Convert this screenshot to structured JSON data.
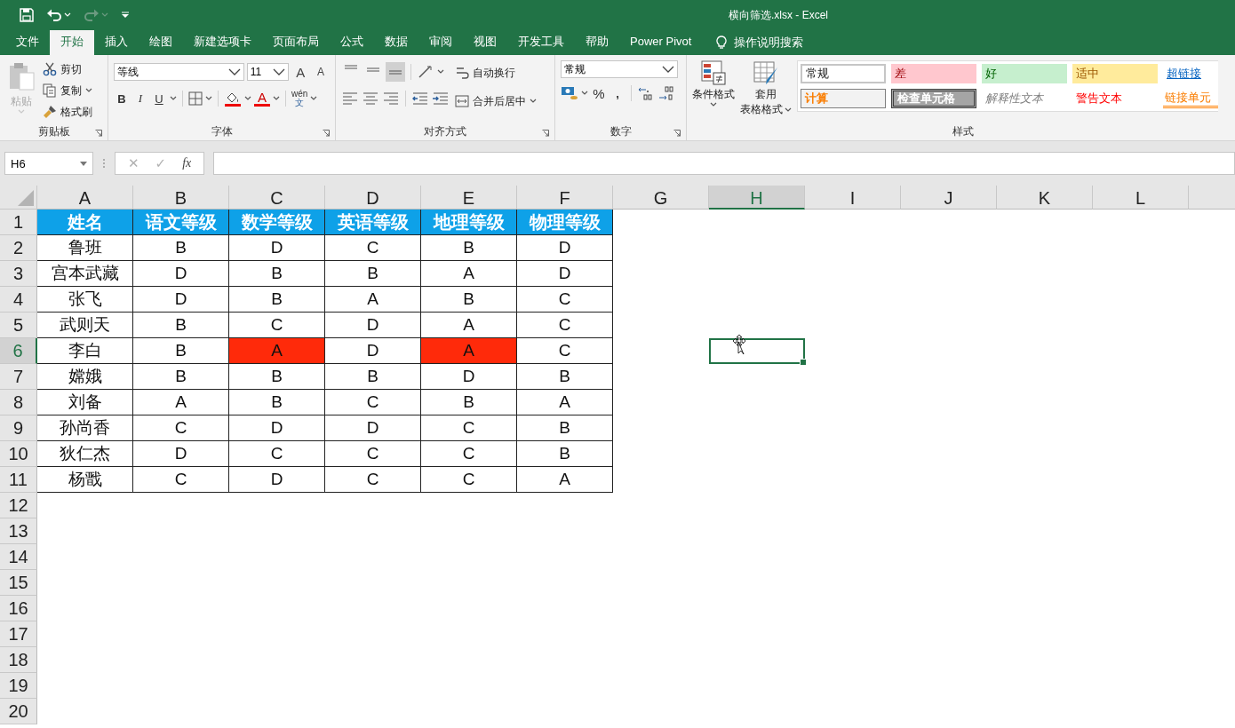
{
  "title_bar": {
    "title": "横向筛选.xlsx  -  Excel"
  },
  "quick_access": {
    "redo_disabled": true
  },
  "menu_tabs": [
    {
      "label": "文件",
      "selected": false,
      "kind": "tab"
    },
    {
      "label": "开始",
      "selected": true,
      "kind": "tab"
    },
    {
      "label": "插入",
      "selected": false,
      "kind": "tab"
    },
    {
      "label": "绘图",
      "selected": false,
      "kind": "tab"
    },
    {
      "label": "新建选项卡",
      "selected": false,
      "kind": "tab"
    },
    {
      "label": "页面布局",
      "selected": false,
      "kind": "tab"
    },
    {
      "label": "公式",
      "selected": false,
      "kind": "tab"
    },
    {
      "label": "数据",
      "selected": false,
      "kind": "tab"
    },
    {
      "label": "审阅",
      "selected": false,
      "kind": "tab"
    },
    {
      "label": "视图",
      "selected": false,
      "kind": "tab"
    },
    {
      "label": "开发工具",
      "selected": false,
      "kind": "tab"
    },
    {
      "label": "帮助",
      "selected": false,
      "kind": "tab"
    },
    {
      "label": "Power Pivot",
      "selected": false,
      "kind": "tab"
    },
    {
      "label": "操作说明搜索",
      "selected": false,
      "kind": "tell_me"
    }
  ],
  "ribbon": {
    "clipboard": {
      "paste": {
        "label": "粘贴",
        "disabled": true
      },
      "cut": "剪切",
      "copy": "复制",
      "format_painter": "格式刷",
      "group_label": "剪贴板"
    },
    "font": {
      "font_name": "等线",
      "font_size": "11",
      "grow": "A",
      "shrink": "A",
      "bold": "B",
      "italic": "I",
      "underline": "U",
      "font_color": "A",
      "phonetic_top": "wén",
      "phonetic_bottom": "文",
      "group_label": "字体"
    },
    "alignment": {
      "vertical_align": [
        {
          "selected": false
        },
        {
          "selected": false
        },
        {
          "selected": true
        }
      ],
      "wrap_text": "自动换行",
      "merge_center": "合并后居中",
      "group_label": "对齐方式"
    },
    "number": {
      "format": "常规",
      "percent": "%",
      "comma": ",",
      "group_label": "数字"
    },
    "styles": {
      "conditional_formatting": "条件格式",
      "format_as_table": [
        "套用",
        "表格格式"
      ],
      "cell_styles": [
        {
          "label": "常规",
          "kind": "normal"
        },
        {
          "label": "差",
          "kind": "bad"
        },
        {
          "label": "好",
          "kind": "good"
        },
        {
          "label": "适中",
          "kind": "neutral"
        },
        {
          "label": "超链接",
          "kind": "hyperlink"
        },
        {
          "label": "计算",
          "kind": "calculation"
        },
        {
          "label": "检查单元格",
          "kind": "check"
        },
        {
          "label": "解释性文本",
          "kind": "explanatory"
        },
        {
          "label": "警告文本",
          "kind": "warning"
        },
        {
          "label": "链接单元",
          "kind": "linked"
        }
      ],
      "group_label": "样式"
    }
  },
  "formula_bar": {
    "name_box": "H6",
    "cancel": "✕",
    "enter": "✓",
    "function": "fx"
  },
  "columns": [
    {
      "label": "A",
      "selected": false
    },
    {
      "label": "B",
      "selected": false
    },
    {
      "label": "C",
      "selected": false
    },
    {
      "label": "D",
      "selected": false
    },
    {
      "label": "E",
      "selected": false
    },
    {
      "label": "F",
      "selected": false
    },
    {
      "label": "G",
      "selected": false
    },
    {
      "label": "H",
      "selected": true
    },
    {
      "label": "I",
      "selected": false
    },
    {
      "label": "J",
      "selected": false
    },
    {
      "label": "K",
      "selected": false
    },
    {
      "label": "L",
      "selected": false
    }
  ],
  "rows": [
    {
      "label": "1",
      "selected": false
    },
    {
      "label": "2",
      "selected": false
    },
    {
      "label": "3",
      "selected": false
    },
    {
      "label": "4",
      "selected": false
    },
    {
      "label": "5",
      "selected": false
    },
    {
      "label": "6",
      "selected": true
    },
    {
      "label": "7",
      "selected": false
    },
    {
      "label": "8",
      "selected": false
    },
    {
      "label": "9",
      "selected": false
    },
    {
      "label": "10",
      "selected": false
    },
    {
      "label": "11",
      "selected": false
    },
    {
      "label": "12",
      "selected": false
    },
    {
      "label": "13",
      "selected": false
    },
    {
      "label": "14",
      "selected": false
    },
    {
      "label": "15",
      "selected": false
    },
    {
      "label": "16",
      "selected": false
    },
    {
      "label": "17",
      "selected": false
    },
    {
      "label": "18",
      "selected": false
    },
    {
      "label": "19",
      "selected": false
    },
    {
      "label": "20",
      "selected": false
    }
  ],
  "table": {
    "header": [
      "姓名",
      "语文等级",
      "数学等级",
      "英语等级",
      "地理等级",
      "物理等级"
    ],
    "rows": [
      [
        {
          "text": "鲁班",
          "highlighted": false
        },
        {
          "text": "B",
          "highlighted": false
        },
        {
          "text": "D",
          "highlighted": false
        },
        {
          "text": "C",
          "highlighted": false
        },
        {
          "text": "B",
          "highlighted": false
        },
        {
          "text": "D",
          "highlighted": false
        }
      ],
      [
        {
          "text": "宫本武藏",
          "highlighted": false
        },
        {
          "text": "D",
          "highlighted": false
        },
        {
          "text": "B",
          "highlighted": false
        },
        {
          "text": "B",
          "highlighted": false
        },
        {
          "text": "A",
          "highlighted": false
        },
        {
          "text": "D",
          "highlighted": false
        }
      ],
      [
        {
          "text": "张飞",
          "highlighted": false
        },
        {
          "text": "D",
          "highlighted": false
        },
        {
          "text": "B",
          "highlighted": false
        },
        {
          "text": "A",
          "highlighted": false
        },
        {
          "text": "B",
          "highlighted": false
        },
        {
          "text": "C",
          "highlighted": false
        }
      ],
      [
        {
          "text": "武则天",
          "highlighted": false
        },
        {
          "text": "B",
          "highlighted": false
        },
        {
          "text": "C",
          "highlighted": false
        },
        {
          "text": "D",
          "highlighted": false
        },
        {
          "text": "A",
          "highlighted": false
        },
        {
          "text": "C",
          "highlighted": false
        }
      ],
      [
        {
          "text": "李白",
          "highlighted": false
        },
        {
          "text": "B",
          "highlighted": false
        },
        {
          "text": "A",
          "highlighted": true
        },
        {
          "text": "D",
          "highlighted": false
        },
        {
          "text": "A",
          "highlighted": true
        },
        {
          "text": "C",
          "highlighted": false
        }
      ],
      [
        {
          "text": "嫦娥",
          "highlighted": false
        },
        {
          "text": "B",
          "highlighted": false
        },
        {
          "text": "B",
          "highlighted": false
        },
        {
          "text": "B",
          "highlighted": false
        },
        {
          "text": "D",
          "highlighted": false
        },
        {
          "text": "B",
          "highlighted": false
        }
      ],
      [
        {
          "text": "刘备",
          "highlighted": false
        },
        {
          "text": "A",
          "highlighted": false
        },
        {
          "text": "B",
          "highlighted": false
        },
        {
          "text": "C",
          "highlighted": false
        },
        {
          "text": "B",
          "highlighted": false
        },
        {
          "text": "A",
          "highlighted": false
        }
      ],
      [
        {
          "text": "孙尚香",
          "highlighted": false
        },
        {
          "text": "C",
          "highlighted": false
        },
        {
          "text": "D",
          "highlighted": false
        },
        {
          "text": "D",
          "highlighted": false
        },
        {
          "text": "C",
          "highlighted": false
        },
        {
          "text": "B",
          "highlighted": false
        }
      ],
      [
        {
          "text": "狄仁杰",
          "highlighted": false
        },
        {
          "text": "D",
          "highlighted": false
        },
        {
          "text": "C",
          "highlighted": false
        },
        {
          "text": "C",
          "highlighted": false
        },
        {
          "text": "C",
          "highlighted": false
        },
        {
          "text": "B",
          "highlighted": false
        }
      ],
      [
        {
          "text": "杨戬",
          "highlighted": false
        },
        {
          "text": "C",
          "highlighted": false
        },
        {
          "text": "D",
          "highlighted": false
        },
        {
          "text": "C",
          "highlighted": false
        },
        {
          "text": "C",
          "highlighted": false
        },
        {
          "text": "A",
          "highlighted": false
        }
      ]
    ]
  }
}
